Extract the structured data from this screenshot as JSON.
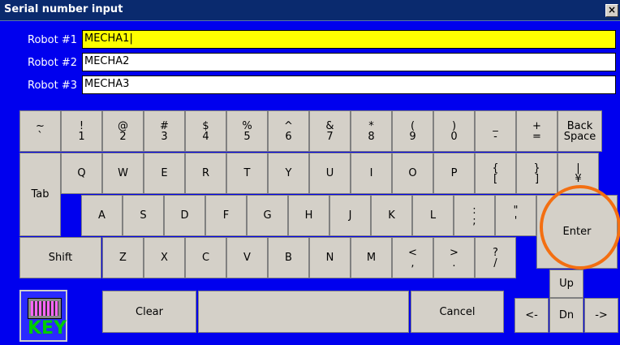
{
  "window": {
    "title": "Serial number input",
    "close_glyph": "×"
  },
  "robots": [
    {
      "label": "Robot #1",
      "value": "MECHA1|",
      "active": true
    },
    {
      "label": "Robot #2",
      "value": "MECHA2"
    },
    {
      "label": "Robot #3",
      "value": "MECHA3"
    }
  ],
  "keyboard": {
    "row1": [
      {
        "top": "~",
        "bot": "`"
      },
      {
        "top": "!",
        "bot": "1"
      },
      {
        "top": "@",
        "bot": "2"
      },
      {
        "top": "#",
        "bot": "3"
      },
      {
        "top": "$",
        "bot": "4"
      },
      {
        "top": "%",
        "bot": "5"
      },
      {
        "top": "^",
        "bot": "6"
      },
      {
        "top": "&",
        "bot": "7"
      },
      {
        "top": "*",
        "bot": "8"
      },
      {
        "top": "(",
        "bot": "9"
      },
      {
        "top": ")",
        "bot": "0"
      },
      {
        "top": "_",
        "bot": "-"
      },
      {
        "top": "+",
        "bot": "="
      }
    ],
    "backspace": {
      "top": "Back",
      "bot": "Space"
    },
    "tab": "Tab",
    "row2": [
      "Q",
      "W",
      "E",
      "R",
      "T",
      "Y",
      "U",
      "I",
      "O",
      "P"
    ],
    "row2_sym": [
      {
        "top": "{",
        "bot": "["
      },
      {
        "top": "}",
        "bot": "]"
      },
      {
        "top": "|",
        "bot": "¥"
      }
    ],
    "row3": [
      "A",
      "S",
      "D",
      "F",
      "G",
      "H",
      "J",
      "K",
      "L"
    ],
    "row3_sym": [
      {
        "top": ":",
        "bot": ";"
      },
      {
        "top": "\"",
        "bot": "'"
      }
    ],
    "enter": "Enter",
    "shift": "Shift",
    "row4": [
      "Z",
      "X",
      "C",
      "V",
      "B",
      "N",
      "M"
    ],
    "row4_sym": [
      {
        "top": "<",
        "bot": ","
      },
      {
        "top": ">",
        "bot": "."
      },
      {
        "top": "?",
        "bot": "/"
      }
    ],
    "up": "Up",
    "clear": "Clear",
    "space": "",
    "cancel": "Cancel",
    "left": "<-",
    "down": "Dn",
    "right": "->",
    "keyboard_icon_text": "KEY"
  },
  "colors": {
    "background": "#0000ee",
    "active_field": "#ffff00",
    "highlight_circle": "#f36f12"
  },
  "icons": {
    "keyboard": "keyboard-icon"
  }
}
